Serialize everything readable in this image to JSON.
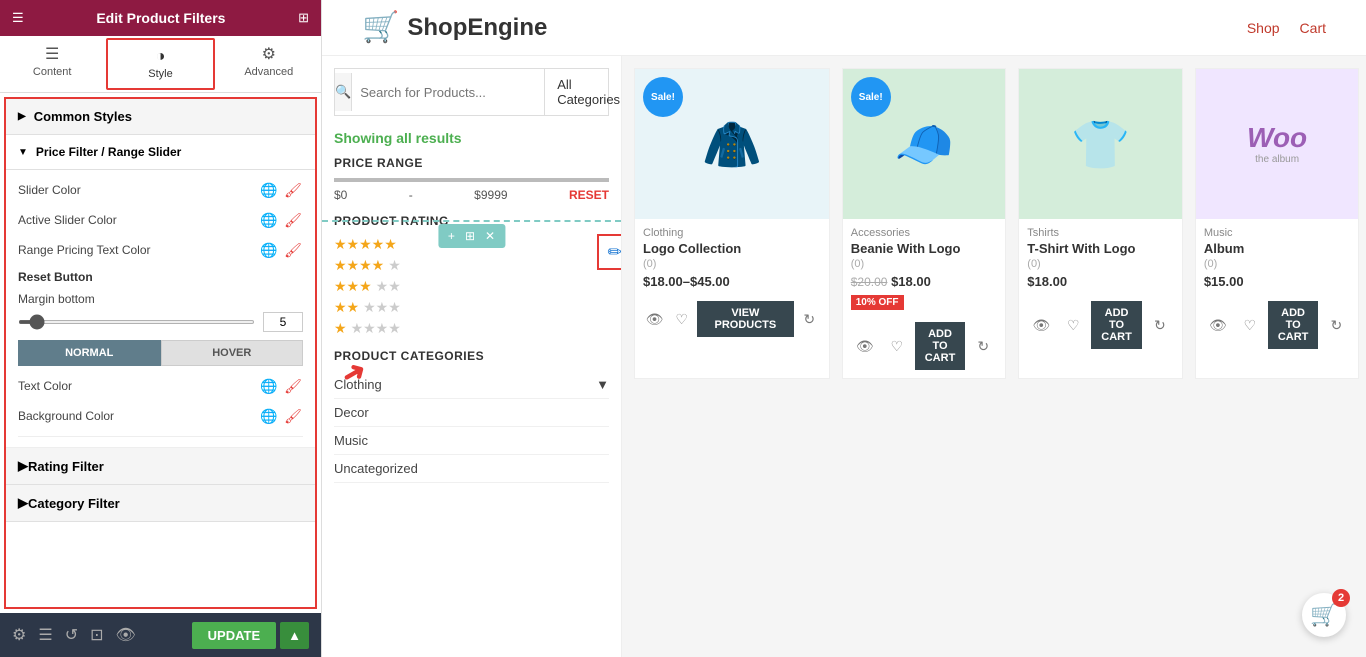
{
  "panel": {
    "title": "Edit Product Filters",
    "tabs": [
      {
        "id": "content",
        "label": "Content",
        "icon": "☰"
      },
      {
        "id": "style",
        "label": "Style",
        "icon": "◑",
        "active": true
      },
      {
        "id": "advanced",
        "label": "Advanced",
        "icon": "⚙"
      }
    ],
    "sections": {
      "common_styles": {
        "label": "Common Styles",
        "expanded": true
      },
      "price_filter": {
        "label": "Price Filter / Range Slider",
        "expanded": true,
        "fields": [
          {
            "id": "slider-color",
            "label": "Slider Color"
          },
          {
            "id": "active-slider-color",
            "label": "Active Slider Color"
          },
          {
            "id": "range-pricing-text-color",
            "label": "Range Pricing Text Color"
          }
        ],
        "reset_button": {
          "label": "Reset Button",
          "margin_bottom": {
            "label": "Margin bottom",
            "value": "5"
          },
          "states": [
            "NORMAL",
            "HOVER"
          ],
          "active_state": "NORMAL",
          "text_color_label": "Text Color",
          "bg_color_label": "Background Color"
        }
      },
      "rating_filter": {
        "label": "Rating Filter",
        "expanded": false
      },
      "category_filter": {
        "label": "Category Filter",
        "expanded": false
      }
    },
    "footer": {
      "update_label": "UPDATE"
    }
  },
  "shop": {
    "logo_text": "ShopEngine",
    "nav": [
      {
        "label": "Shop"
      },
      {
        "label": "Cart"
      }
    ],
    "search": {
      "placeholder": "Search for Products...",
      "category_label": "All Categories"
    },
    "showing_results": "Showing all results",
    "price_range": {
      "title": "PRICE RANGE",
      "min": "$0",
      "max": "$9999",
      "reset_label": "RESET"
    },
    "product_rating": {
      "title": "PRODUCT RATING"
    },
    "product_categories": {
      "title": "PRODUCT CATEGORIES",
      "items": [
        "Clothing",
        "Decor",
        "Music",
        "Uncategorized"
      ]
    },
    "products": [
      {
        "id": 1,
        "category": "Clothing",
        "name": "Logo Collection",
        "reviews": "(0)",
        "price": "$18.00–$45.00",
        "has_sale": true,
        "has_view_btn": true,
        "btn_label": "VIEW PRODUCTS",
        "emoji": "🧥"
      },
      {
        "id": 2,
        "category": "Accessories",
        "name": "Beanie With Logo",
        "reviews": "(0)",
        "price_old": "$20.00",
        "price_new": "$18.00",
        "discount": "10% OFF",
        "has_sale": true,
        "btn_label": "ADD TO CART",
        "emoji": "🧢"
      },
      {
        "id": 3,
        "category": "Tshirts",
        "name": "T-Shirt With Logo",
        "reviews": "(0)",
        "price": "$18.00",
        "btn_label": "ADD TO CART",
        "emoji": "👕"
      },
      {
        "id": 4,
        "category": "Music",
        "name": "Album",
        "reviews": "(0)",
        "price": "$15.00",
        "btn_label": "ADD TO CART",
        "is_woo": true
      }
    ]
  },
  "cart_count": "2"
}
